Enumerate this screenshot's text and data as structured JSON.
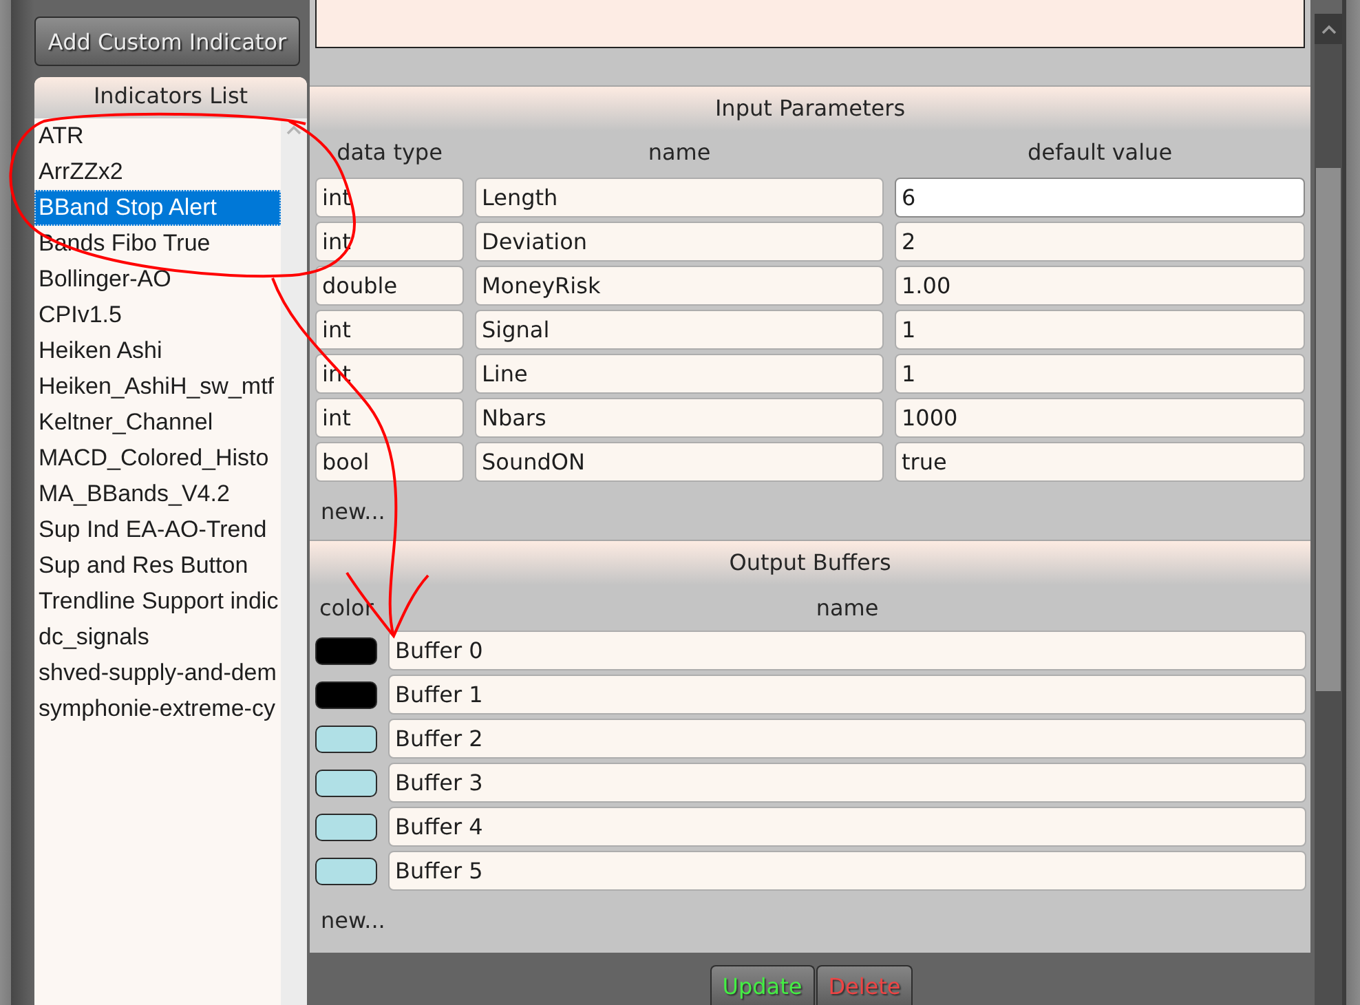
{
  "sidebar": {
    "add_button": "Add Custom Indicator",
    "list_title": "Indicators List",
    "items": [
      {
        "label": "ATR",
        "selected": false
      },
      {
        "label": "ArrZZx2",
        "selected": false
      },
      {
        "label": "BBand Stop Alert",
        "selected": true
      },
      {
        "label": "Bands Fibo True",
        "selected": false
      },
      {
        "label": "Bollinger-AO",
        "selected": false
      },
      {
        "label": "CPIv1.5",
        "selected": false
      },
      {
        "label": "Heiken Ashi",
        "selected": false
      },
      {
        "label": "Heiken_AshiH_sw_mtf",
        "selected": false
      },
      {
        "label": "Keltner_Channel",
        "selected": false
      },
      {
        "label": "MACD_Colored_Histo",
        "selected": false
      },
      {
        "label": "MA_BBands_V4.2",
        "selected": false
      },
      {
        "label": "Sup Ind EA-AO-Trend",
        "selected": false
      },
      {
        "label": "Sup and Res Button",
        "selected": false
      },
      {
        "label": "Trendline Support indic",
        "selected": false
      },
      {
        "label": "dc_signals",
        "selected": false
      },
      {
        "label": "shved-supply-and-dem",
        "selected": false
      },
      {
        "label": "symphonie-extreme-cy",
        "selected": false
      }
    ]
  },
  "input_parameters": {
    "title": "Input Parameters",
    "columns": [
      "data type",
      "name",
      "default value"
    ],
    "rows": [
      {
        "data_type": "int",
        "name": "Length",
        "default_value": "6",
        "focused": true
      },
      {
        "data_type": "int",
        "name": "Deviation",
        "default_value": "2",
        "focused": false
      },
      {
        "data_type": "double",
        "name": "MoneyRisk",
        "default_value": "1.00",
        "focused": false
      },
      {
        "data_type": "int",
        "name": "Signal",
        "default_value": "1",
        "focused": false
      },
      {
        "data_type": "int",
        "name": "Line",
        "default_value": "1",
        "focused": false
      },
      {
        "data_type": "int",
        "name": "Nbars",
        "default_value": "1000",
        "focused": false
      },
      {
        "data_type": "bool",
        "name": "SoundON",
        "default_value": "true",
        "focused": false
      }
    ],
    "new_link": "new..."
  },
  "output_buffers": {
    "title": "Output Buffers",
    "columns": [
      "color",
      "name"
    ],
    "rows": [
      {
        "color": "#000000",
        "name": "Buffer 0"
      },
      {
        "color": "#000000",
        "name": "Buffer 1"
      },
      {
        "color": "#b0e0e6",
        "name": "Buffer 2"
      },
      {
        "color": "#b0e0e6",
        "name": "Buffer 3"
      },
      {
        "color": "#b0e0e6",
        "name": "Buffer 4"
      },
      {
        "color": "#b0e0e6",
        "name": "Buffer 5"
      }
    ],
    "new_link": "new..."
  },
  "buttons": [
    {
      "label": "Update",
      "color": "#44ee44"
    },
    {
      "label": "Delete",
      "color": "#ee4444"
    }
  ]
}
